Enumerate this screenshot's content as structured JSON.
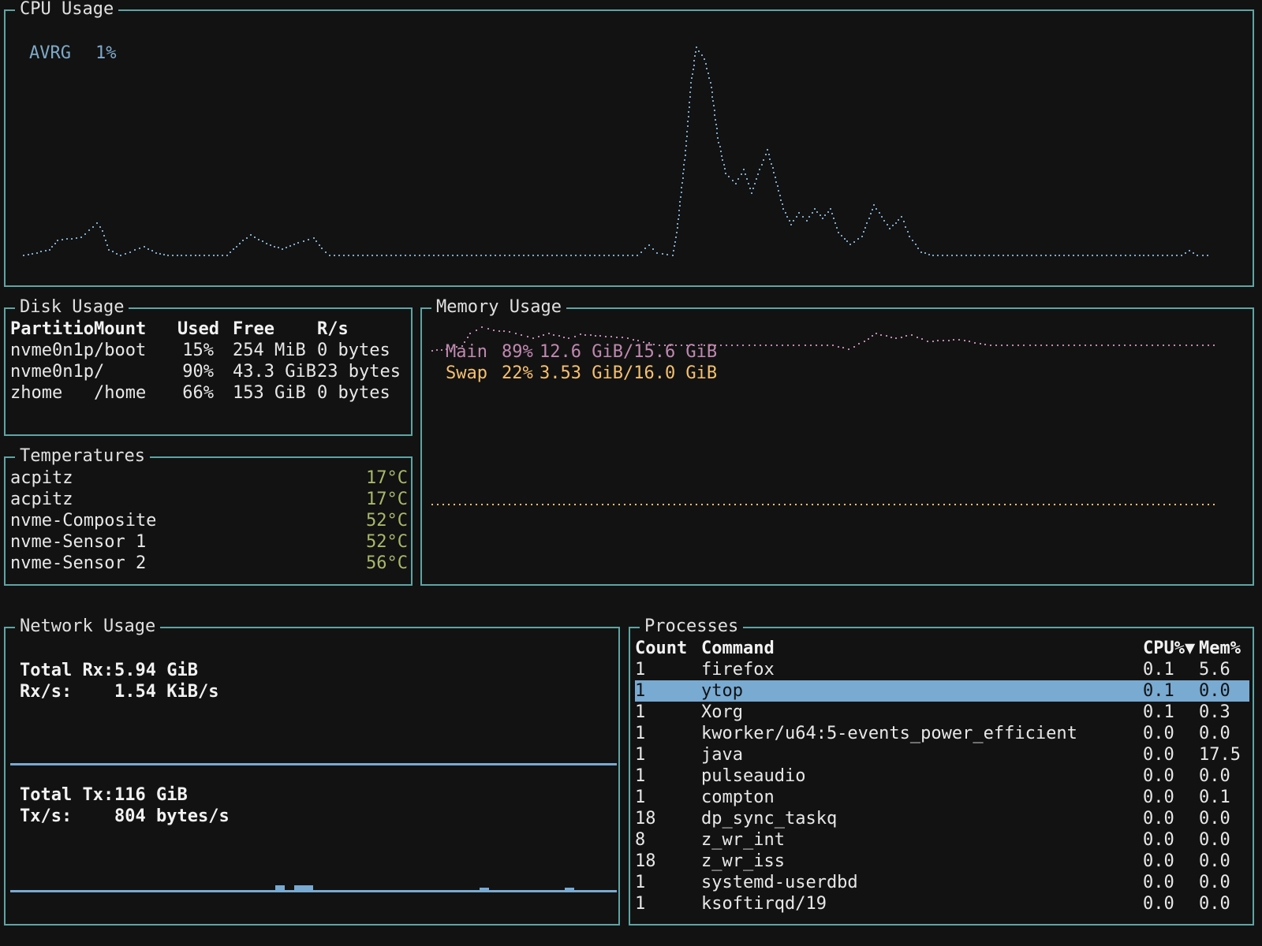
{
  "colors": {
    "border": "#5fa4a4",
    "cpu_line": "#7ea9c9",
    "mem_main": "#c089b0",
    "mem_swap": "#f5c06f",
    "net": "#78aad2",
    "temp": "#a8b86a",
    "highlight": "#78aad2"
  },
  "cpu": {
    "title": "CPU Usage",
    "series_label": "AVRG",
    "series_value": "1%"
  },
  "disk": {
    "title": "Disk Usage",
    "headers": [
      "Partitio",
      "Mount",
      "Used",
      "Free",
      "R/s"
    ],
    "rows": [
      [
        "nvme0n1p",
        "/boot",
        "15%",
        "254 MiB",
        "0 bytes"
      ],
      [
        "nvme0n1p",
        "/",
        "90%",
        "43.3 GiB",
        "23 bytes"
      ],
      [
        "zhome",
        "/home",
        "66%",
        "153 GiB",
        "0 bytes"
      ]
    ]
  },
  "temperatures": {
    "title": "Temperatures",
    "rows": [
      [
        "acpitz",
        "17°C"
      ],
      [
        "acpitz",
        "17°C"
      ],
      [
        "nvme-Composite",
        "52°C"
      ],
      [
        "nvme-Sensor 1",
        "52°C"
      ],
      [
        "nvme-Sensor 2",
        "56°C"
      ]
    ]
  },
  "memory": {
    "title": "Memory Usage",
    "main_label": "Main",
    "main_pct": "89%",
    "main_amount": "12.6 GiB/15.6 GiB",
    "swap_label": "Swap",
    "swap_pct": "22%",
    "swap_amount": "3.53 GiB/16.0 GiB"
  },
  "network": {
    "title": "Network Usage",
    "total_rx_label": "Total Rx:",
    "total_rx": "5.94 GiB",
    "rx_rate_label": "Rx/s:",
    "rx_rate": "1.54 KiB/s",
    "total_tx_label": "Total Tx:",
    "total_tx": "116 GiB",
    "tx_rate_label": "Tx/s:",
    "tx_rate": "804 bytes/s"
  },
  "processes": {
    "title": "Processes",
    "headers": [
      "Count",
      "Command",
      "CPU%▼",
      "Mem%"
    ],
    "selected_index": 1,
    "rows": [
      [
        "1",
        "firefox",
        "0.1",
        "5.6"
      ],
      [
        "1",
        "ytop",
        "0.1",
        "0.0"
      ],
      [
        "1",
        "Xorg",
        "0.1",
        "0.3"
      ],
      [
        "1",
        "kworker/u64:5-events_power_efficient",
        "0.0",
        "0.0"
      ],
      [
        "1",
        "java",
        "0.0",
        "17.5"
      ],
      [
        "1",
        "pulseaudio",
        "0.0",
        "0.0"
      ],
      [
        "1",
        "compton",
        "0.0",
        "0.1"
      ],
      [
        "18",
        "dp_sync_taskq",
        "0.0",
        "0.0"
      ],
      [
        "8",
        "z_wr_int",
        "0.0",
        "0.0"
      ],
      [
        "18",
        "z_wr_iss",
        "0.0",
        "0.0"
      ],
      [
        "1",
        "systemd-userdbd",
        "0.0",
        "0.0"
      ],
      [
        "1",
        "ksoftirqd/19",
        "0.0",
        "0.0"
      ]
    ]
  }
}
